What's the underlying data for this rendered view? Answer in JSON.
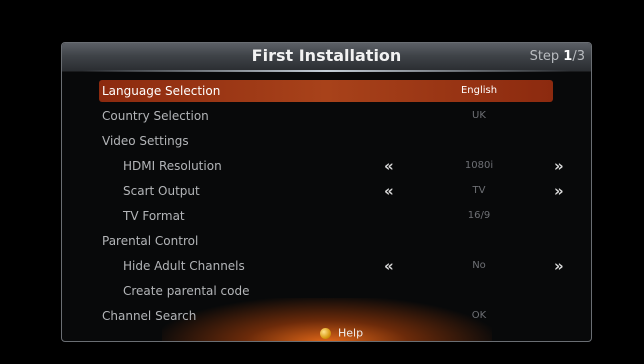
{
  "header": {
    "title": "First Installation",
    "step_prefix": "Step ",
    "step_current": "1",
    "step_total": "/3"
  },
  "menu": [
    {
      "label": "Language Selection",
      "value": "English",
      "selected": true
    },
    {
      "label": "Country Selection",
      "value": "UK"
    },
    {
      "label": "Video Settings",
      "value": ""
    },
    {
      "label": "HDMI Resolution",
      "value": "1080i",
      "arrows": true
    },
    {
      "label": "Scart Output",
      "value": "TV",
      "arrows": true
    },
    {
      "label": "TV Format",
      "value": "16/9"
    },
    {
      "label": "Parental Control",
      "value": ""
    },
    {
      "label": "Hide Adult Channels",
      "value": "No",
      "arrows": true
    },
    {
      "label": "Create parental code",
      "value": ""
    },
    {
      "label": "Channel Search",
      "value": "OK"
    }
  ],
  "arrows": {
    "left": "«",
    "right": "»"
  },
  "footer": {
    "help_label": "Help"
  },
  "colors": {
    "selection": "#a8421a",
    "help_button": "#e0a21a"
  }
}
